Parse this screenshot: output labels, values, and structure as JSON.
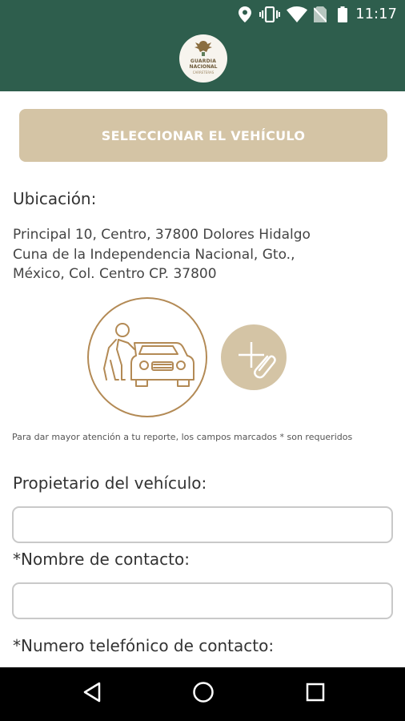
{
  "status_bar": {
    "time": "11:17",
    "icons": [
      "location-icon",
      "vibrate-icon",
      "wifi-icon",
      "no-sim-icon",
      "battery-icon"
    ]
  },
  "app_bar": {
    "logo_line1": "GUARDIA",
    "logo_line2": "NACIONAL",
    "logo_line3": "CARRETERAS"
  },
  "main": {
    "select_vehicle_label": "SELECCIONAR EL VEHÍCULO",
    "location_label": "Ubicación:",
    "address_line1": "Principal 10, Centro, 37800 Dolores Hidalgo",
    "address_line2": "Cuna de la Independencia Nacional, Gto.,",
    "address_line3": "México, Col. Centro CP. 37800",
    "required_note": "Para dar mayor atención a tu reporte, los campos marcados * son requeridos"
  },
  "form": {
    "owner_label": "Propietario del vehículo:",
    "owner_value": "",
    "contact_name_label": "*Nombre de contacto:",
    "contact_name_value": "",
    "contact_phone_label": "*Numero telefónico de contacto:"
  },
  "nav_bar": {
    "buttons": [
      "back-icon",
      "home-icon",
      "recents-icon"
    ]
  },
  "colors": {
    "primary_green": "#2e5e4d",
    "accent_gold": "#d4c4a5",
    "illustration_brown": "#b38a55"
  }
}
